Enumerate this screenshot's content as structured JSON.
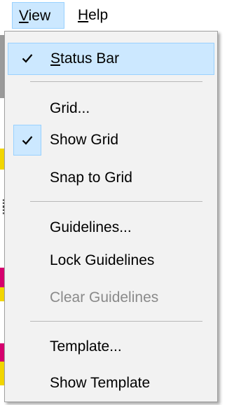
{
  "menubar": {
    "view": {
      "mnemonic": "V",
      "rest": "iew"
    },
    "help": {
      "mnemonic": "H",
      "rest": "elp"
    }
  },
  "view_menu": {
    "status_bar": {
      "mnemonic": "S",
      "rest": "tatus Bar",
      "checked": true
    },
    "grid": {
      "label": "Grid..."
    },
    "show_grid": {
      "label": "Show Grid",
      "checked": true
    },
    "snap_to_grid": {
      "label": "Snap to Grid"
    },
    "guidelines": {
      "label": "Guidelines..."
    },
    "lock_guidelines": {
      "label": "Lock Guidelines"
    },
    "clear_guidelines": {
      "label": "Clear Guidelines",
      "disabled": true
    },
    "template": {
      "label": "Template..."
    },
    "show_template": {
      "label": "Show Template"
    }
  },
  "icons": {
    "check": "checkmark-icon"
  },
  "colors": {
    "highlight": "#cce8ff",
    "highlight_border": "#99d1ff",
    "menu_background": "#f2f2f2",
    "disabled_text": "#8a8a8a",
    "accent_yellow": "#f2d600",
    "accent_magenta": "#d6006e"
  }
}
